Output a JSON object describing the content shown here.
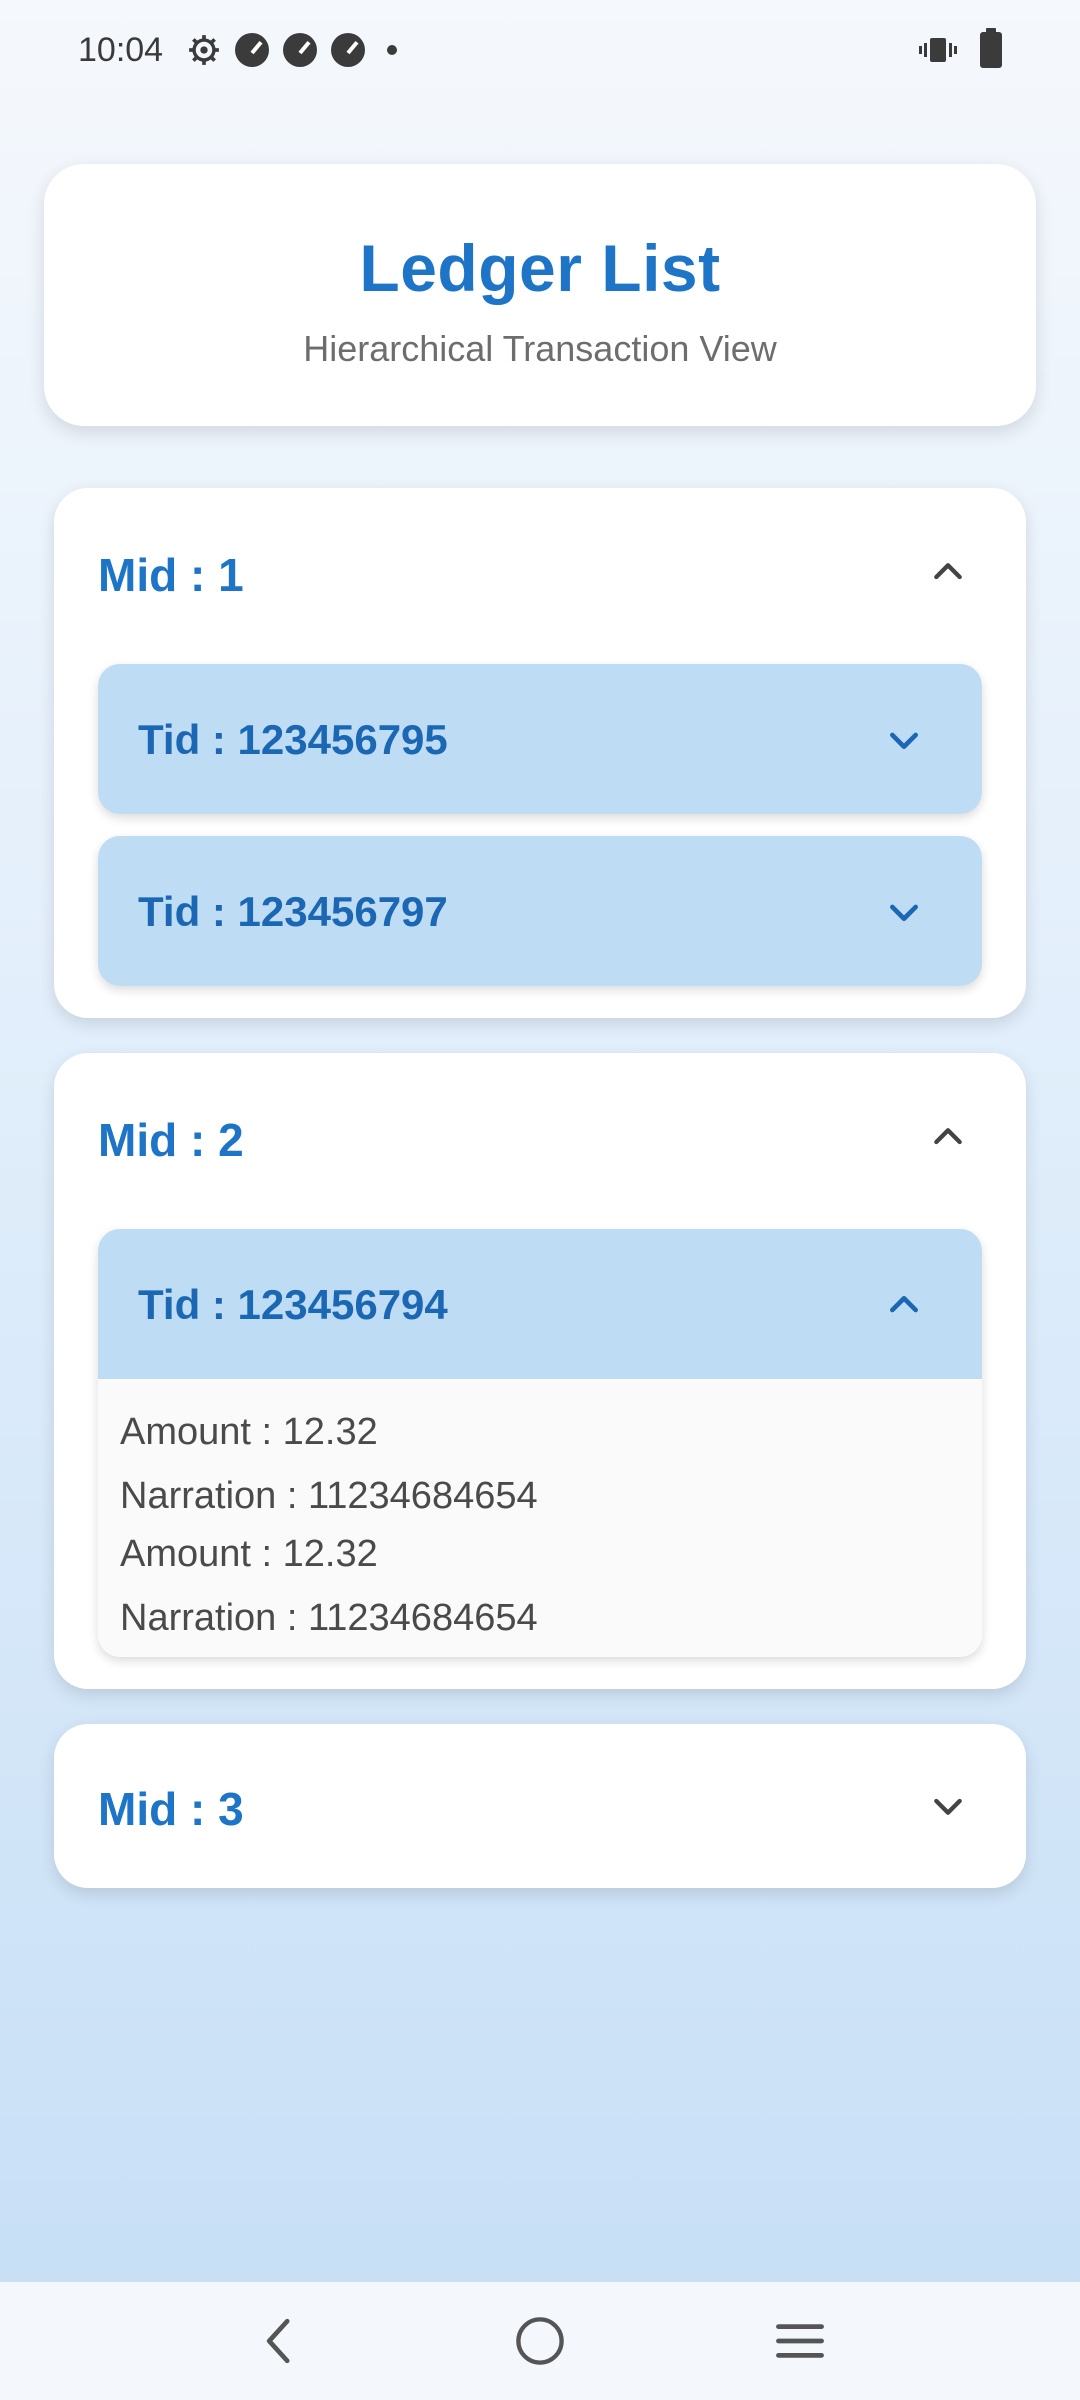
{
  "status_bar": {
    "time": "10:04",
    "left_icons": [
      "settings-icon",
      "speed-icon",
      "speed-icon",
      "speed-icon",
      "dot-icon"
    ],
    "right_icons": [
      "vibrate-icon",
      "battery-icon"
    ]
  },
  "header": {
    "title": "Ledger List",
    "subtitle": "Hierarchical Transaction View"
  },
  "mids": [
    {
      "label": "Mid : 1",
      "expanded": true,
      "tids": [
        {
          "label": "Tid : 123456795",
          "expanded": false
        },
        {
          "label": "Tid : 123456797",
          "expanded": false
        }
      ]
    },
    {
      "label": "Mid : 2",
      "expanded": true,
      "tids": [
        {
          "label": "Tid : 123456794",
          "expanded": true,
          "transactions": [
            {
              "amount": "Amount : 12.32",
              "narration": "Narration : 11234684654"
            },
            {
              "amount": "Amount : 12.32",
              "narration": "Narration : 11234684654"
            }
          ]
        }
      ]
    },
    {
      "label": "Mid : 3",
      "expanded": false,
      "tids": []
    }
  ],
  "nav_bar": {
    "buttons": [
      "back-icon",
      "home-icon",
      "recents-icon"
    ]
  },
  "colors": {
    "accent": "#1e74c6",
    "tid_header_bg": "#bedcf4",
    "card_bg": "#ffffff"
  }
}
